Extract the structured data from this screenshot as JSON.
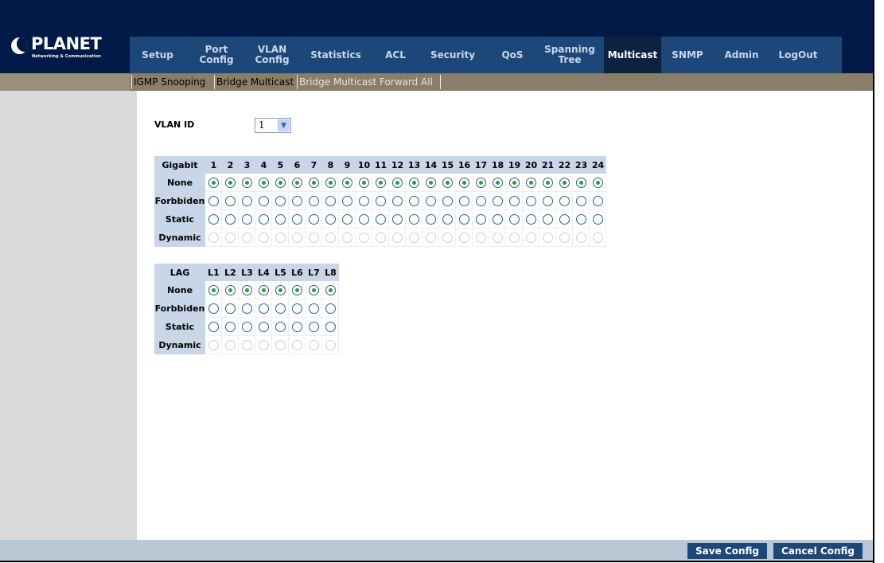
{
  "brand": {
    "name": "PLANET",
    "tagline": "Networking & Communication"
  },
  "nav": [
    {
      "label": "Setup",
      "active": false
    },
    {
      "label": "Port Config",
      "active": false
    },
    {
      "label": "VLAN Config",
      "active": false
    },
    {
      "label": "Statistics",
      "active": false
    },
    {
      "label": "ACL",
      "active": false
    },
    {
      "label": "Security",
      "active": false
    },
    {
      "label": "QoS",
      "active": false
    },
    {
      "label": "Spanning Tree",
      "active": false
    },
    {
      "label": "Multicast",
      "active": true
    },
    {
      "label": "SNMP",
      "active": false
    },
    {
      "label": "Admin",
      "active": false
    },
    {
      "label": "LogOut",
      "active": false
    }
  ],
  "subnav": [
    {
      "label": "IGMP Snooping",
      "active": false
    },
    {
      "label": "Bridge Multicast",
      "active": false
    },
    {
      "label": "Bridge Multicast Forward All",
      "active": true
    }
  ],
  "vlan": {
    "label": "VLAN ID",
    "value": "1"
  },
  "gigabit": {
    "header": "Gigabit",
    "ports": [
      "1",
      "2",
      "3",
      "4",
      "5",
      "6",
      "7",
      "8",
      "9",
      "10",
      "11",
      "12",
      "13",
      "14",
      "15",
      "16",
      "17",
      "18",
      "19",
      "20",
      "21",
      "22",
      "23",
      "24"
    ],
    "rows": [
      {
        "label": "None",
        "selected": true,
        "disabled": false
      },
      {
        "label": "Forbbiden",
        "selected": false,
        "disabled": false
      },
      {
        "label": "Static",
        "selected": false,
        "disabled": false
      },
      {
        "label": "Dynamic",
        "selected": false,
        "disabled": true
      }
    ]
  },
  "lag": {
    "header": "LAG",
    "ports": [
      "L1",
      "L2",
      "L3",
      "L4",
      "L5",
      "L6",
      "L7",
      "L8"
    ],
    "rows": [
      {
        "label": "None",
        "selected": true,
        "disabled": false
      },
      {
        "label": "Forbbiden",
        "selected": false,
        "disabled": false
      },
      {
        "label": "Static",
        "selected": false,
        "disabled": false
      },
      {
        "label": "Dynamic",
        "selected": false,
        "disabled": true
      }
    ]
  },
  "footer": {
    "save_label": "Save Config",
    "cancel_label": "Cancel Config"
  },
  "colors": {
    "header_bg": "#001a47",
    "nav_bg": "#1c4778",
    "subnav_bg": "#8a7e68",
    "table_header": "#c9d6e8",
    "radio_selected": "#2f9a2f"
  }
}
